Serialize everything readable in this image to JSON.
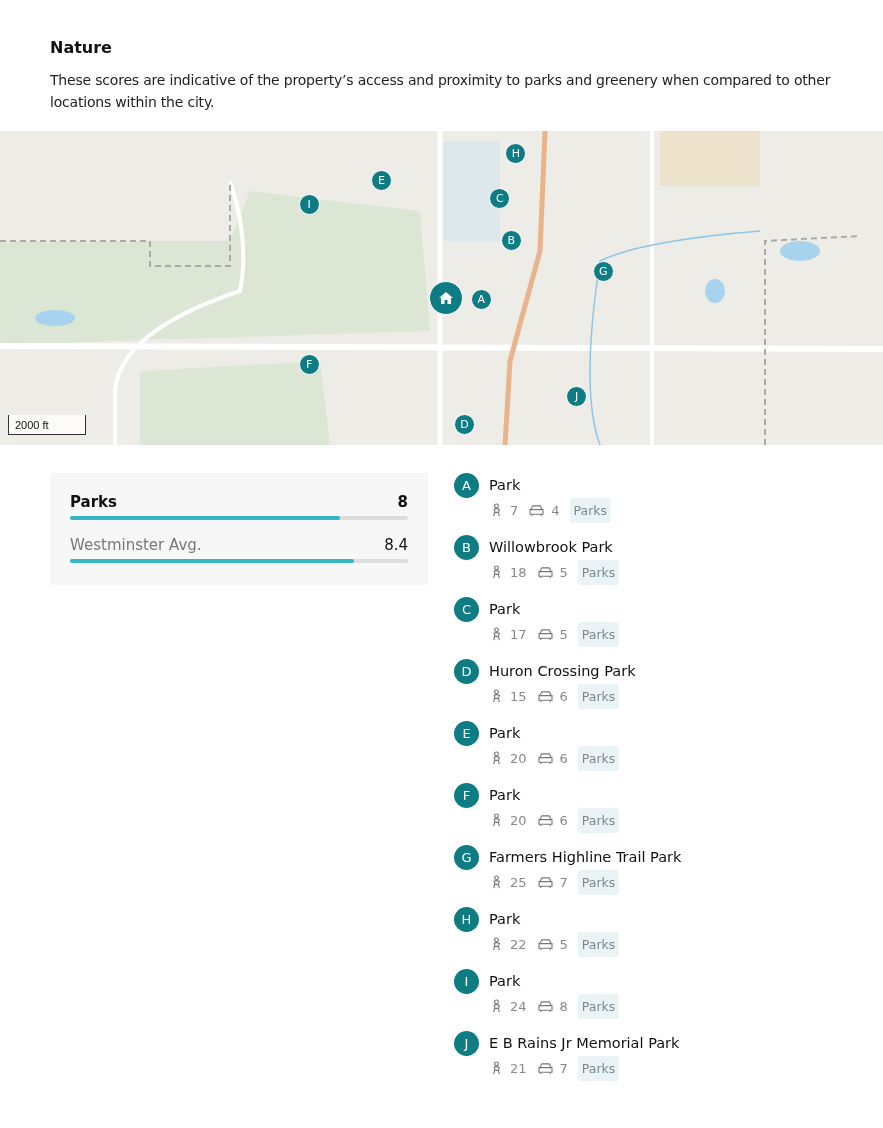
{
  "section": {
    "title": "Nature",
    "description": "These scores are indicative of the property’s access and proximity to parks and greenery when compared to other locations within the city."
  },
  "map": {
    "markers": [
      "H",
      "E",
      "I",
      "C",
      "B",
      "G",
      "A",
      "F",
      "J",
      "D"
    ],
    "scale": "2000 ft"
  },
  "scores": [
    {
      "label": "Parks",
      "value": "8",
      "level": 0.8,
      "kind": "primary"
    },
    {
      "label": "Westminster Avg.",
      "value": "8.4",
      "level": 0.84,
      "kind": "average"
    }
  ],
  "places": [
    {
      "letter": "A",
      "name": "Park",
      "walk": "7",
      "drive": "4",
      "tag": "Parks"
    },
    {
      "letter": "B",
      "name": "Willowbrook Park",
      "walk": "18",
      "drive": "5",
      "tag": "Parks"
    },
    {
      "letter": "C",
      "name": "Park",
      "walk": "17",
      "drive": "5",
      "tag": "Parks"
    },
    {
      "letter": "D",
      "name": "Huron Crossing Park",
      "walk": "15",
      "drive": "6",
      "tag": "Parks"
    },
    {
      "letter": "E",
      "name": "Park",
      "walk": "20",
      "drive": "6",
      "tag": "Parks"
    },
    {
      "letter": "F",
      "name": "Park",
      "walk": "20",
      "drive": "6",
      "tag": "Parks"
    },
    {
      "letter": "G",
      "name": "Farmers Highline Trail Park",
      "walk": "25",
      "drive": "7",
      "tag": "Parks"
    },
    {
      "letter": "H",
      "name": "Park",
      "walk": "22",
      "drive": "5",
      "tag": "Parks"
    },
    {
      "letter": "I",
      "name": "Park",
      "walk": "24",
      "drive": "8",
      "tag": "Parks"
    },
    {
      "letter": "J",
      "name": "E B Rains Jr Memorial Park",
      "walk": "21",
      "drive": "7",
      "tag": "Parks"
    }
  ]
}
